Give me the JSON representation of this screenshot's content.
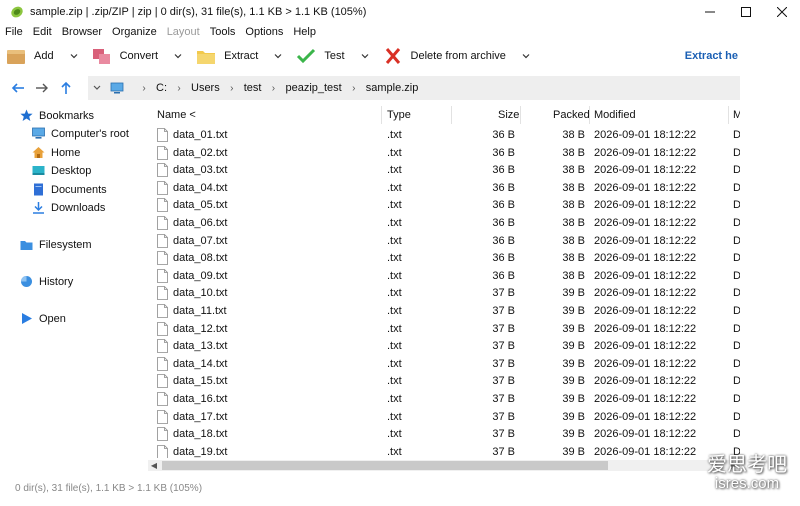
{
  "window": {
    "title": "sample.zip | .zip/ZIP | zip | 0 dir(s), 31 file(s), 1.1 KB > 1.1 KB (105%)"
  },
  "menu": [
    {
      "label": "File",
      "disabled": false
    },
    {
      "label": "Edit",
      "disabled": false
    },
    {
      "label": "Browser",
      "disabled": false
    },
    {
      "label": "Organize",
      "disabled": false
    },
    {
      "label": "Layout",
      "disabled": true
    },
    {
      "label": "Tools",
      "disabled": false
    },
    {
      "label": "Options",
      "disabled": false
    },
    {
      "label": "Help",
      "disabled": false
    }
  ],
  "toolbar": {
    "add_label": "Add",
    "convert_label": "Convert",
    "extract_label": "Extract",
    "test_label": "Test",
    "delete_label": "Delete from archive",
    "extract_here_label": "Extract he"
  },
  "breadcrumb": [
    "C:",
    "Users",
    "test",
    "peazip_test",
    "sample.zip"
  ],
  "sidebar": {
    "bookmarks": "Bookmarks",
    "computer_root": "Computer's root",
    "home": "Home",
    "desktop": "Desktop",
    "documents": "Documents",
    "downloads": "Downloads",
    "filesystem": "Filesystem",
    "history": "History",
    "open": "Open"
  },
  "columns": {
    "name": "Name <",
    "type": "Type",
    "size": "Size",
    "packed": "Packed",
    "modified": "Modified",
    "extra": "M"
  },
  "files": [
    {
      "name": "data_01.txt",
      "type": ".txt",
      "size": "36 B",
      "packed": "38 B",
      "modified": "2026-09-01 18:12:22",
      "extra": "D"
    },
    {
      "name": "data_02.txt",
      "type": ".txt",
      "size": "36 B",
      "packed": "38 B",
      "modified": "2026-09-01 18:12:22",
      "extra": "D"
    },
    {
      "name": "data_03.txt",
      "type": ".txt",
      "size": "36 B",
      "packed": "38 B",
      "modified": "2026-09-01 18:12:22",
      "extra": "D"
    },
    {
      "name": "data_04.txt",
      "type": ".txt",
      "size": "36 B",
      "packed": "38 B",
      "modified": "2026-09-01 18:12:22",
      "extra": "D"
    },
    {
      "name": "data_05.txt",
      "type": ".txt",
      "size": "36 B",
      "packed": "38 B",
      "modified": "2026-09-01 18:12:22",
      "extra": "D"
    },
    {
      "name": "data_06.txt",
      "type": ".txt",
      "size": "36 B",
      "packed": "38 B",
      "modified": "2026-09-01 18:12:22",
      "extra": "D"
    },
    {
      "name": "data_07.txt",
      "type": ".txt",
      "size": "36 B",
      "packed": "38 B",
      "modified": "2026-09-01 18:12:22",
      "extra": "D"
    },
    {
      "name": "data_08.txt",
      "type": ".txt",
      "size": "36 B",
      "packed": "38 B",
      "modified": "2026-09-01 18:12:22",
      "extra": "D"
    },
    {
      "name": "data_09.txt",
      "type": ".txt",
      "size": "36 B",
      "packed": "38 B",
      "modified": "2026-09-01 18:12:22",
      "extra": "D"
    },
    {
      "name": "data_10.txt",
      "type": ".txt",
      "size": "37 B",
      "packed": "39 B",
      "modified": "2026-09-01 18:12:22",
      "extra": "D"
    },
    {
      "name": "data_11.txt",
      "type": ".txt",
      "size": "37 B",
      "packed": "39 B",
      "modified": "2026-09-01 18:12:22",
      "extra": "D"
    },
    {
      "name": "data_12.txt",
      "type": ".txt",
      "size": "37 B",
      "packed": "39 B",
      "modified": "2026-09-01 18:12:22",
      "extra": "D"
    },
    {
      "name": "data_13.txt",
      "type": ".txt",
      "size": "37 B",
      "packed": "39 B",
      "modified": "2026-09-01 18:12:22",
      "extra": "D"
    },
    {
      "name": "data_14.txt",
      "type": ".txt",
      "size": "37 B",
      "packed": "39 B",
      "modified": "2026-09-01 18:12:22",
      "extra": "D"
    },
    {
      "name": "data_15.txt",
      "type": ".txt",
      "size": "37 B",
      "packed": "39 B",
      "modified": "2026-09-01 18:12:22",
      "extra": "D"
    },
    {
      "name": "data_16.txt",
      "type": ".txt",
      "size": "37 B",
      "packed": "39 B",
      "modified": "2026-09-01 18:12:22",
      "extra": "D"
    },
    {
      "name": "data_17.txt",
      "type": ".txt",
      "size": "37 B",
      "packed": "39 B",
      "modified": "2026-09-01 18:12:22",
      "extra": "D"
    },
    {
      "name": "data_18.txt",
      "type": ".txt",
      "size": "37 B",
      "packed": "39 B",
      "modified": "2026-09-01 18:12:22",
      "extra": "D"
    },
    {
      "name": "data_19.txt",
      "type": ".txt",
      "size": "37 B",
      "packed": "39 B",
      "modified": "2026-09-01 18:12:22",
      "extra": "D"
    }
  ],
  "status": {
    "text": "0 dir(s), 31 file(s), 1.1 KB > 1.1 KB (105%)"
  },
  "watermark": {
    "cn": "爱思考吧",
    "en": "isres.com"
  },
  "colors": {
    "accent": "#1a5fb4",
    "breadcrumb_bg": "#eeeeee",
    "status_text": "#888888"
  }
}
